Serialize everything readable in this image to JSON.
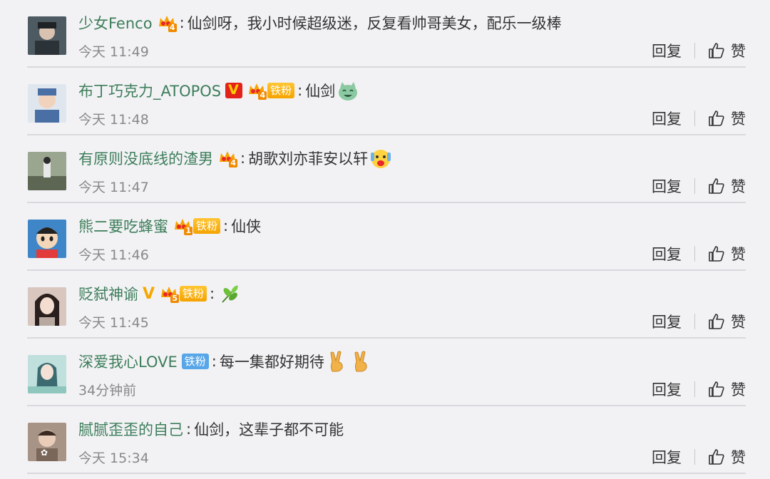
{
  "comments": [
    {
      "user": "少女Fenco",
      "badges": {
        "crown": "4",
        "fan": null,
        "v": null
      },
      "text": "仙剑呀，我小时候超级迷，反复看帅哥美女，配乐一级棒",
      "emoji": [],
      "time": "今天 11:49",
      "reply": "回复",
      "like": "赞",
      "avatar_color": "#5a6a74"
    },
    {
      "user": "布丁巧克力_ATOPOS",
      "badges": {
        "crown": "4",
        "fan": "铁粉",
        "v": "red"
      },
      "text": "仙剑",
      "emoji": [
        "laughing-cat-emoji"
      ],
      "time": "今天 11:48",
      "reply": "回复",
      "like": "赞",
      "avatar_color": "#6d89b6"
    },
    {
      "user": "有原则没底线的渣男",
      "badges": {
        "crown": "4",
        "fan": null,
        "v": null
      },
      "text": "胡歌刘亦菲安以轩",
      "emoji": [
        "shock-face-emoji"
      ],
      "time": "今天 11:47",
      "reply": "回复",
      "like": "赞",
      "avatar_color": "#7e8a75"
    },
    {
      "user": "熊二要吃蜂蜜",
      "badges": {
        "crown": "1",
        "fan": "铁粉",
        "v": null
      },
      "text": "仙侠",
      "emoji": [],
      "time": "今天 11:46",
      "reply": "回复",
      "like": "赞",
      "avatar_color": "#3f86c9"
    },
    {
      "user": "贬弑神谕",
      "badges": {
        "crown": "5",
        "fan": "铁粉",
        "v": "gold"
      },
      "text": "",
      "emoji": [
        "leaf-emoji"
      ],
      "time": "今天 11:45",
      "reply": "回复",
      "like": "赞",
      "avatar_color": "#c9b6ad"
    },
    {
      "user": "深爱我心LOVE",
      "badges": {
        "crown": null,
        "fan": "铁粉",
        "v": null,
        "fan_style": "blue"
      },
      "text": "每一集都好期待",
      "emoji": [
        "victory-hand-emoji",
        "victory-hand-emoji"
      ],
      "time": "34分钟前",
      "reply": "回复",
      "like": "赞",
      "avatar_color": "#9fc8c4"
    },
    {
      "user": "腻腻歪歪的自己",
      "badges": {
        "crown": null,
        "fan": null,
        "v": null
      },
      "text": "仙剑，这辈子都不可能",
      "emoji": [],
      "time": "今天 15:34",
      "reply": "回复",
      "like": "赞",
      "avatar_color": "#8a7a6e"
    }
  ],
  "colors": {
    "username": "#3d7d5a",
    "background": "#f2f2f5",
    "time": "#888888"
  }
}
